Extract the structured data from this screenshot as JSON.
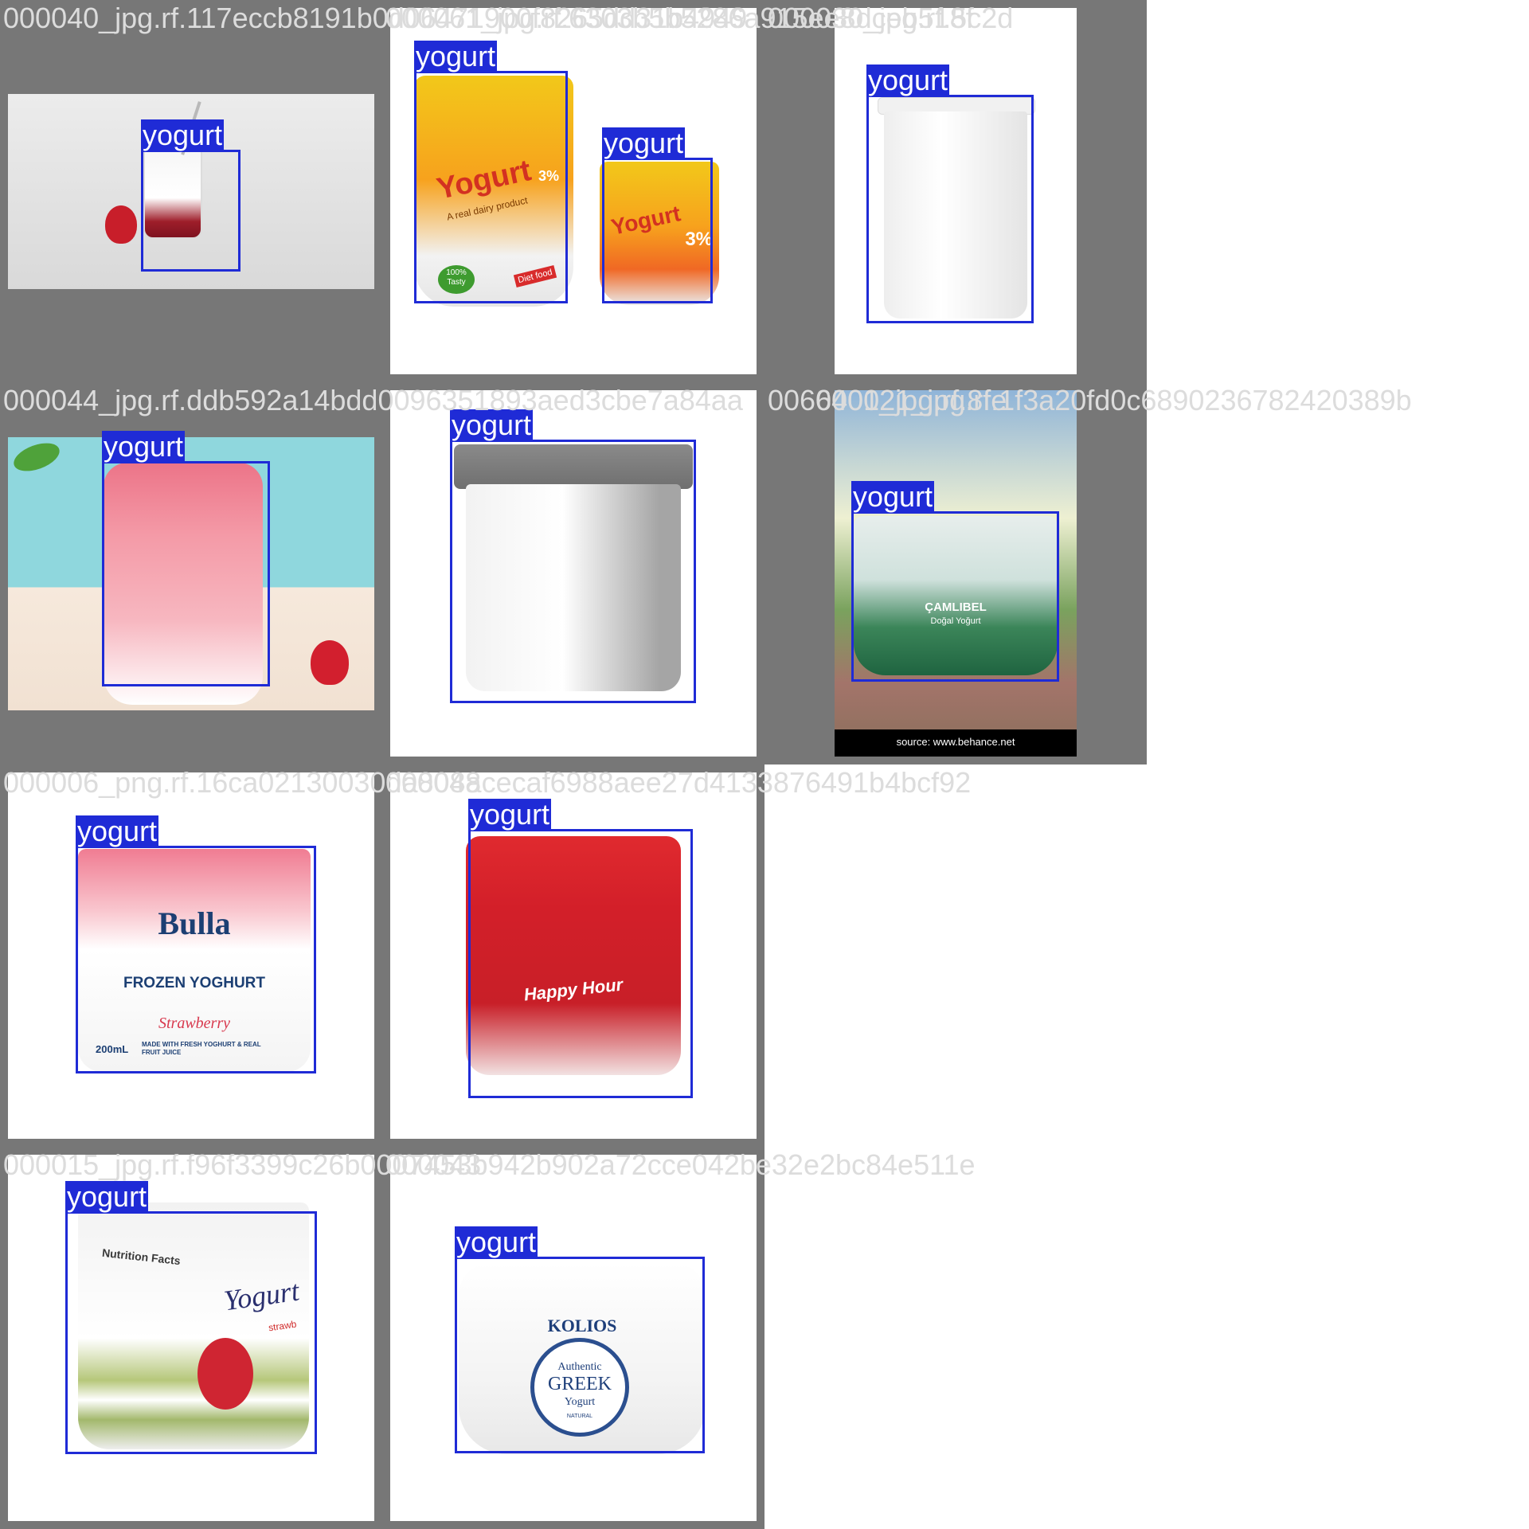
{
  "colors": {
    "tile_background": "#777777",
    "box_stroke": "#1f2bd6",
    "caption_text": "#dcdcdc",
    "page_background": "#ffffff"
  },
  "tiles": [
    {
      "caption": "000040_jpg.rf.117eccb8191b0d06471900f8265dd31b4949",
      "labels": [
        "yogurt"
      ]
    },
    {
      "caption": "000061_jpg.rf.6303b5b5286a915ee8dceb518f",
      "labels": [
        "yogurt",
        "yogurt"
      ],
      "pack_print": {
        "brand": "Yogurt",
        "tagline": "A real dairy product",
        "percent": "3%",
        "badge": "100% Tasty",
        "tag": "Diet food"
      }
    },
    {
      "caption": "000030_jpg.rf.5c2d",
      "labels": [
        "yogurt"
      ]
    },
    {
      "caption": "000044_jpg.rf.ddb592a14bdd0096351893aed3cbe7a84aa",
      "labels": [
        "yogurt"
      ]
    },
    {
      "caption": "0066401_jpg.rf.8fe",
      "labels": [
        "yogurt"
      ]
    },
    {
      "caption": "000021_jpg.rf.1f3a20fd0c6890236782420389b",
      "labels": [
        "yogurt"
      ],
      "pack_print": {
        "brand": "ÇAMLIBEL",
        "product": "Doğal Yoğurt"
      },
      "credit": "source: www.behance.net"
    },
    {
      "caption": "000006_png.rf.16ca02130030da808acecaf6988aee27d4133876491b4bcf92",
      "labels": [
        "yogurt"
      ],
      "pack_print": {
        "brand": "Bulla",
        "title": "FROZEN YOGHURT",
        "flavor": "Strawberry",
        "volume": "200mL",
        "note": "MADE WITH FRESH YOGHURT & REAL FRUIT JUICE"
      }
    },
    {
      "caption": "000048",
      "labels": [
        "yogurt"
      ],
      "pack_print": {
        "brand": "Happy Hour"
      }
    },
    {
      "caption": "000015_jpg.rf.f96f3399c26b0007453b942b902a72cce042be32e2bc84e511e",
      "labels": [
        "yogurt"
      ],
      "pack_print": {
        "heading": "Nutrition Facts",
        "script": "Yogurt",
        "flavor": "strawb"
      }
    },
    {
      "caption": "000043",
      "labels": [
        "yogurt"
      ],
      "pack_print": {
        "brand": "KOLIOS",
        "line1": "Authentic",
        "line2": "GREEK",
        "line3": "Yogurt",
        "small": "NATURAL"
      }
    }
  ]
}
